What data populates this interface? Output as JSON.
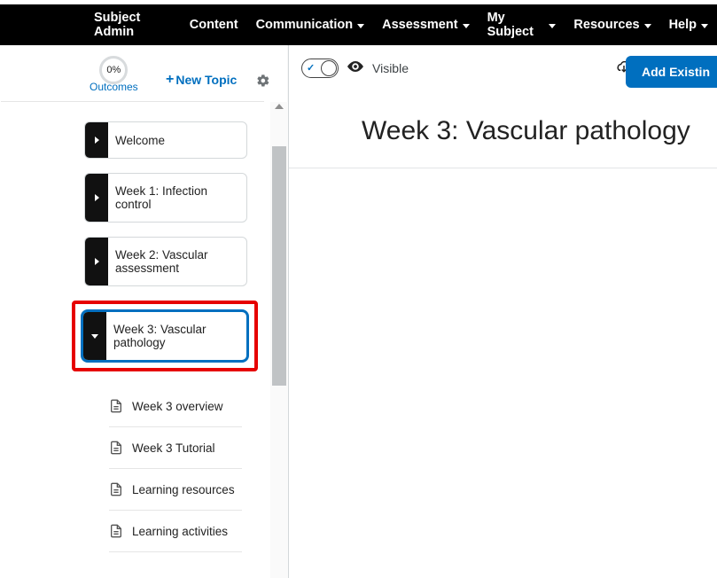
{
  "nav": [
    {
      "label": "Subject Admin",
      "dropdown": false
    },
    {
      "label": "Content",
      "dropdown": false
    },
    {
      "label": "Communication",
      "dropdown": true
    },
    {
      "label": "Assessment",
      "dropdown": true
    },
    {
      "label": "My Subject",
      "dropdown": true
    },
    {
      "label": "Resources",
      "dropdown": true
    },
    {
      "label": "Help",
      "dropdown": true
    }
  ],
  "sidebar_header": {
    "outcomes_percent": "0%",
    "outcomes_label": "Outcomes",
    "new_topic": "New Topic"
  },
  "topics": {
    "welcome": "Welcome",
    "week1": "Week 1: Infection control",
    "week2": "Week 2: Vascular assessment",
    "week3": "Week 3: Vascular pathology"
  },
  "subitems": {
    "overview": "Week 3 overview",
    "tutorial": "Week 3 Tutorial",
    "resources": "Learning resources",
    "activities": "Learning activities"
  },
  "main": {
    "visibility": "Visible",
    "add_button": "Add Existin",
    "title": "Week 3: Vascular pathology"
  }
}
